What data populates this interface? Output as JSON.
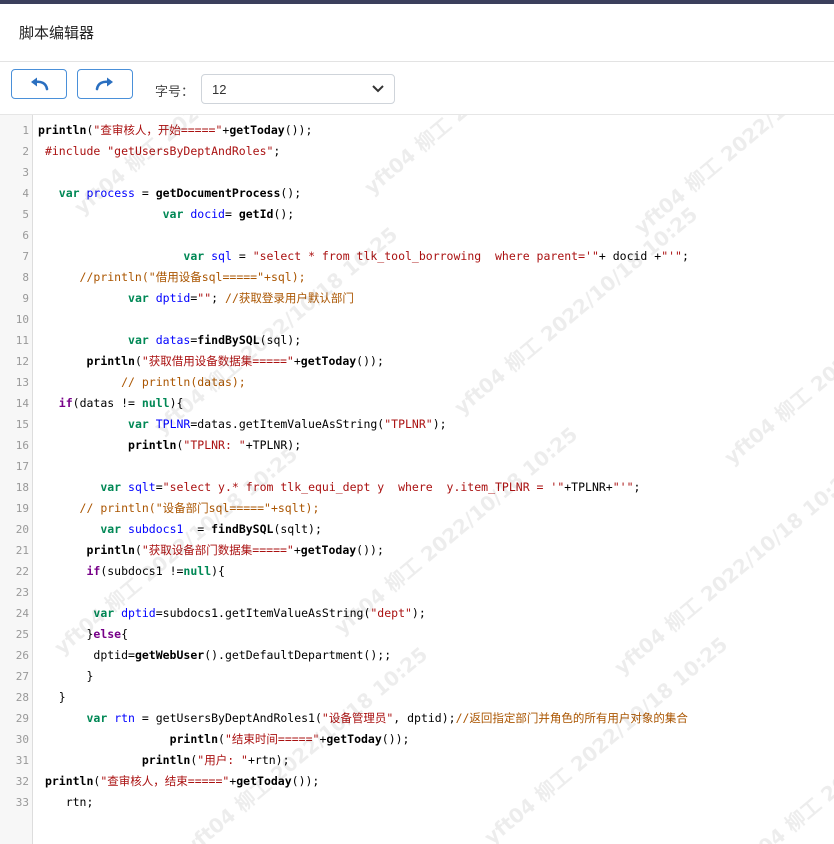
{
  "window": {
    "title": "脚本编辑器"
  },
  "toolbar": {
    "undo_icon": "undo-icon",
    "redo_icon": "redo-icon",
    "font_size_label": "字号：",
    "font_size_value": "12"
  },
  "watermark": {
    "text": "yft04 柳工 2022/10/18 10:25"
  },
  "lines": [
    {
      "n": "1",
      "indent": "",
      "parts": [
        [
          "fn",
          "println"
        ],
        [
          "",
          "("
        ],
        [
          "str",
          "\"查审核人，开始=====\""
        ],
        [
          "",
          "+"
        ],
        [
          "fn",
          "getToday"
        ],
        [
          "",
          "());"
        ]
      ]
    },
    {
      "n": "2",
      "indent": " ",
      "parts": [
        [
          "str",
          "#include \"getUsersByDeptAndRoles\""
        ],
        [
          "",
          ";"
        ]
      ]
    },
    {
      "n": "3",
      "indent": "",
      "parts": []
    },
    {
      "n": "4",
      "indent": "   ",
      "parts": [
        [
          "kw2",
          "var"
        ],
        [
          "",
          " "
        ],
        [
          "var",
          "process"
        ],
        [
          "",
          " = "
        ],
        [
          "fn",
          "getDocumentProcess"
        ],
        [
          "",
          "();"
        ]
      ]
    },
    {
      "n": "5",
      "indent": "                  ",
      "parts": [
        [
          "kw2",
          "var"
        ],
        [
          "",
          " "
        ],
        [
          "var",
          "docid"
        ],
        [
          "",
          "= "
        ],
        [
          "fn",
          "getId"
        ],
        [
          "",
          "();"
        ]
      ]
    },
    {
      "n": "6",
      "indent": "",
      "parts": []
    },
    {
      "n": "7",
      "indent": "                     ",
      "parts": [
        [
          "kw2",
          "var"
        ],
        [
          "",
          " "
        ],
        [
          "var",
          "sql"
        ],
        [
          "",
          " = "
        ],
        [
          "str",
          "\"select * from tlk_tool_borrowing  where parent='\""
        ],
        [
          "",
          "+ docid +"
        ],
        [
          "str",
          "\"'\""
        ],
        [
          "",
          ";"
        ]
      ]
    },
    {
      "n": "8",
      "indent": "      ",
      "parts": [
        [
          "cm",
          "//println(\"借用设备sql=====\"+sql);"
        ]
      ]
    },
    {
      "n": "9",
      "indent": "             ",
      "parts": [
        [
          "kw2",
          "var"
        ],
        [
          "",
          " "
        ],
        [
          "var",
          "dptid"
        ],
        [
          "",
          "="
        ],
        [
          "str",
          "\"\""
        ],
        [
          "",
          "; "
        ],
        [
          "cm",
          "//获取登录用户默认部门"
        ]
      ]
    },
    {
      "n": "10",
      "indent": "",
      "parts": []
    },
    {
      "n": "11",
      "indent": "             ",
      "parts": [
        [
          "kw2",
          "var"
        ],
        [
          "",
          " "
        ],
        [
          "var",
          "datas"
        ],
        [
          "",
          "="
        ],
        [
          "fn",
          "findBySQL"
        ],
        [
          "",
          "(sql);"
        ]
      ]
    },
    {
      "n": "12",
      "indent": "       ",
      "parts": [
        [
          "fn",
          "println"
        ],
        [
          "",
          "("
        ],
        [
          "str",
          "\"获取借用设备数据集=====\""
        ],
        [
          "",
          "+"
        ],
        [
          "fn",
          "getToday"
        ],
        [
          "",
          "());"
        ]
      ]
    },
    {
      "n": "13",
      "indent": "            ",
      "parts": [
        [
          "cm",
          "// println(datas);"
        ]
      ]
    },
    {
      "n": "14",
      "indent": "   ",
      "parts": [
        [
          "kw",
          "if"
        ],
        [
          "",
          "(datas != "
        ],
        [
          "kw2",
          "null"
        ],
        [
          "",
          "){"
        ]
      ]
    },
    {
      "n": "15",
      "indent": "             ",
      "parts": [
        [
          "kw2",
          "var"
        ],
        [
          "",
          " "
        ],
        [
          "var",
          "TPLNR"
        ],
        [
          "",
          "=datas.getItemValueAsString("
        ],
        [
          "str",
          "\"TPLNR\""
        ],
        [
          "",
          ");"
        ]
      ]
    },
    {
      "n": "16",
      "indent": "             ",
      "parts": [
        [
          "fn",
          "println"
        ],
        [
          "",
          "("
        ],
        [
          "str",
          "\"TPLNR: \""
        ],
        [
          "",
          "+TPLNR);"
        ]
      ]
    },
    {
      "n": "17",
      "indent": "",
      "parts": []
    },
    {
      "n": "18",
      "indent": "         ",
      "parts": [
        [
          "kw2",
          "var"
        ],
        [
          "",
          " "
        ],
        [
          "var",
          "sqlt"
        ],
        [
          "",
          "="
        ],
        [
          "str",
          "\"select y.* from tlk_equi_dept y  where  y.item_TPLNR = '\""
        ],
        [
          "",
          "+TPLNR+"
        ],
        [
          "str",
          "\"'\""
        ],
        [
          "",
          ";"
        ]
      ]
    },
    {
      "n": "19",
      "indent": "      ",
      "parts": [
        [
          "cm",
          "// println(\"设备部门sql=====\"+sqlt);"
        ]
      ]
    },
    {
      "n": "20",
      "indent": "         ",
      "parts": [
        [
          "kw2",
          "var"
        ],
        [
          "",
          " "
        ],
        [
          "var",
          "subdocs1"
        ],
        [
          "",
          "  = "
        ],
        [
          "fn",
          "findBySQL"
        ],
        [
          "",
          "(sqlt);"
        ]
      ]
    },
    {
      "n": "21",
      "indent": "       ",
      "parts": [
        [
          "fn",
          "println"
        ],
        [
          "",
          "("
        ],
        [
          "str",
          "\"获取设备部门数据集=====\""
        ],
        [
          "",
          "+"
        ],
        [
          "fn",
          "getToday"
        ],
        [
          "",
          "());"
        ]
      ]
    },
    {
      "n": "22",
      "indent": "       ",
      "parts": [
        [
          "kw",
          "if"
        ],
        [
          "",
          "(subdocs1 !="
        ],
        [
          "kw2",
          "null"
        ],
        [
          "",
          "){"
        ]
      ]
    },
    {
      "n": "23",
      "indent": "",
      "parts": []
    },
    {
      "n": "24",
      "indent": "        ",
      "parts": [
        [
          "kw2",
          "var"
        ],
        [
          "",
          " "
        ],
        [
          "var",
          "dptid"
        ],
        [
          "",
          "=subdocs1.getItemValueAsString("
        ],
        [
          "str",
          "\"dept\""
        ],
        [
          "",
          ");"
        ]
      ]
    },
    {
      "n": "25",
      "indent": "       ",
      "parts": [
        [
          "",
          "}"
        ],
        [
          "kw",
          "else"
        ],
        [
          "",
          "{"
        ]
      ]
    },
    {
      "n": "26",
      "indent": "        ",
      "parts": [
        [
          "",
          "dptid="
        ],
        [
          "fn",
          "getWebUser"
        ],
        [
          "",
          "().getDefaultDepartment();;"
        ]
      ]
    },
    {
      "n": "27",
      "indent": "       ",
      "parts": [
        [
          "",
          "}"
        ]
      ]
    },
    {
      "n": "28",
      "indent": "   ",
      "parts": [
        [
          "",
          "}"
        ]
      ]
    },
    {
      "n": "29",
      "indent": "       ",
      "parts": [
        [
          "kw2",
          "var"
        ],
        [
          "",
          " "
        ],
        [
          "var",
          "rtn"
        ],
        [
          "",
          " = getUsersByDeptAndRoles1("
        ],
        [
          "str",
          "\"设备管理员\""
        ],
        [
          "",
          ", dptid);"
        ],
        [
          "cm",
          "//返回指定部门并角色的所有用户对象的集合"
        ]
      ]
    },
    {
      "n": "30",
      "indent": "                   ",
      "parts": [
        [
          "fn",
          "println"
        ],
        [
          "",
          "("
        ],
        [
          "str",
          "\"结束时间=====\""
        ],
        [
          "",
          "+"
        ],
        [
          "fn",
          "getToday"
        ],
        [
          "",
          "());"
        ]
      ]
    },
    {
      "n": "31",
      "indent": "               ",
      "parts": [
        [
          "fn",
          "println"
        ],
        [
          "",
          "("
        ],
        [
          "str",
          "\"用户: \""
        ],
        [
          "",
          "+rtn);"
        ]
      ]
    },
    {
      "n": "32",
      "indent": " ",
      "parts": [
        [
          "fn",
          "println"
        ],
        [
          "",
          "("
        ],
        [
          "str",
          "\"查审核人，结束=====\""
        ],
        [
          "",
          "+"
        ],
        [
          "fn",
          "getToday"
        ],
        [
          "",
          "());"
        ]
      ]
    },
    {
      "n": "33",
      "indent": "    ",
      "parts": [
        [
          "",
          "rtn;"
        ]
      ]
    }
  ]
}
